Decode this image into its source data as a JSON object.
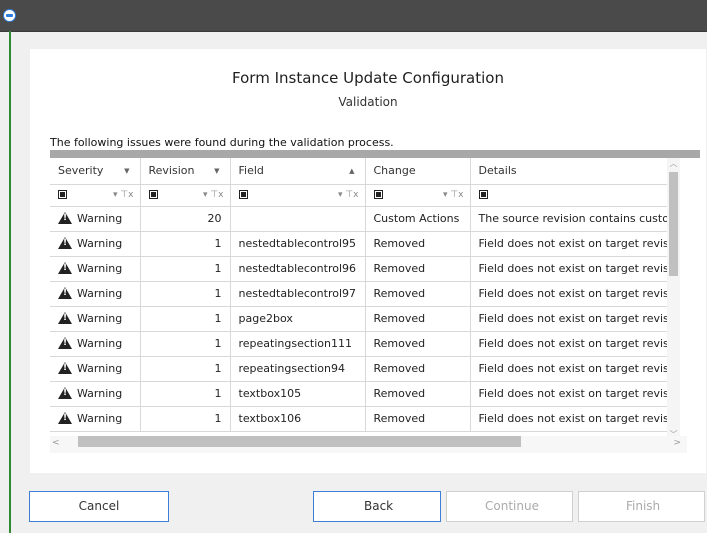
{
  "dialog": {
    "title": "Form Instance Update Configuration",
    "subtitle": "Validation",
    "info": "The following issues were found during the validation process."
  },
  "table": {
    "columns": [
      "Severity",
      "Revision",
      "Field",
      "Change",
      "Details"
    ],
    "rows": [
      {
        "severity": "Warning",
        "revision": "20",
        "field": "",
        "change": "Custom Actions",
        "details": "The source revision contains custo"
      },
      {
        "severity": "Warning",
        "revision": "1",
        "field": "nestedtablecontrol95",
        "change": "Removed",
        "details": "Field does not exist on target revisi"
      },
      {
        "severity": "Warning",
        "revision": "1",
        "field": "nestedtablecontrol96",
        "change": "Removed",
        "details": "Field does not exist on target revisi"
      },
      {
        "severity": "Warning",
        "revision": "1",
        "field": "nestedtablecontrol97",
        "change": "Removed",
        "details": "Field does not exist on target revisi"
      },
      {
        "severity": "Warning",
        "revision": "1",
        "field": "page2box",
        "change": "Removed",
        "details": "Field does not exist on target revisi"
      },
      {
        "severity": "Warning",
        "revision": "1",
        "field": "repeatingsection111",
        "change": "Removed",
        "details": "Field does not exist on target revisi"
      },
      {
        "severity": "Warning",
        "revision": "1",
        "field": "repeatingsection94",
        "change": "Removed",
        "details": "Field does not exist on target revisi"
      },
      {
        "severity": "Warning",
        "revision": "1",
        "field": "textbox105",
        "change": "Removed",
        "details": "Field does not exist on target revisi"
      },
      {
        "severity": "Warning",
        "revision": "1",
        "field": "textbox106",
        "change": "Removed",
        "details": "Field does not exist on target revisi"
      }
    ]
  },
  "buttons": {
    "cancel": "Cancel",
    "back": "Back",
    "continue": "Continue",
    "finish": "Finish"
  },
  "colors": {
    "accent": "#3d7fd6",
    "title_bar": "#4a4a4a",
    "side_bar": "#2f8a34"
  }
}
